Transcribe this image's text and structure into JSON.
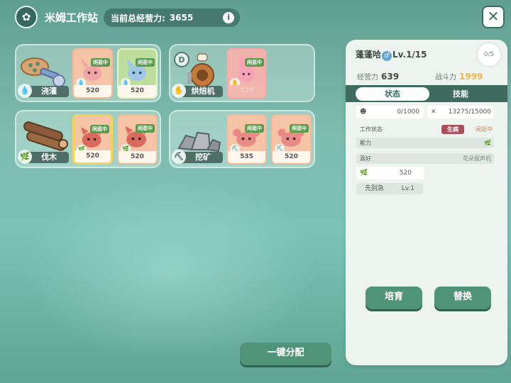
{
  "header": {
    "title": "米姆工作站",
    "total_label": "当前总经营力:",
    "total_value": "3655"
  },
  "stations": [
    {
      "label": "浇灌",
      "cards": [
        {
          "status": "闲逛中",
          "power": "520"
        },
        {
          "status": "闲逛中",
          "power": "520"
        }
      ]
    },
    {
      "label": "烘焙机",
      "badge": "D",
      "cards": [
        {
          "status": "闲逛中",
          "power": "520"
        }
      ]
    },
    {
      "label": "伐木",
      "cards": [
        {
          "status": "闲逛中",
          "power": "520"
        },
        {
          "status": "闲逛中",
          "power": "520"
        }
      ]
    },
    {
      "label": "挖矿",
      "cards": [
        {
          "status": "闲逛中",
          "power": "535"
        },
        {
          "status": "闲逛中",
          "power": "520"
        }
      ]
    }
  ],
  "detail": {
    "name": "蓬蓬哈",
    "level": "Lv.1/15",
    "slots": "0/5",
    "operation_label": "经营力",
    "operation_value": "639",
    "combat_label": "战斗力",
    "combat_value": "1999",
    "tabs": [
      "状态",
      "技能"
    ],
    "mood": "0/1000",
    "stamina": "13275/15000",
    "work_status_label": "工作状态",
    "work_status_badge": "生病",
    "work_status_value": "闲逛中",
    "ability_label": "能力",
    "hobby_label": "喜好",
    "hobby_value": "花朵留声机",
    "skill_power": "520",
    "trait_label": "先别急",
    "trait_level": "Lv.1",
    "cultivate_button": "培育",
    "replace_button": "替换"
  },
  "assign_button": "一键分配",
  "colors": {
    "accent": "#4f9379",
    "combat": "#f1b341",
    "idle_tag": "#5a9a4c",
    "sick_tag": "#a8505a"
  }
}
